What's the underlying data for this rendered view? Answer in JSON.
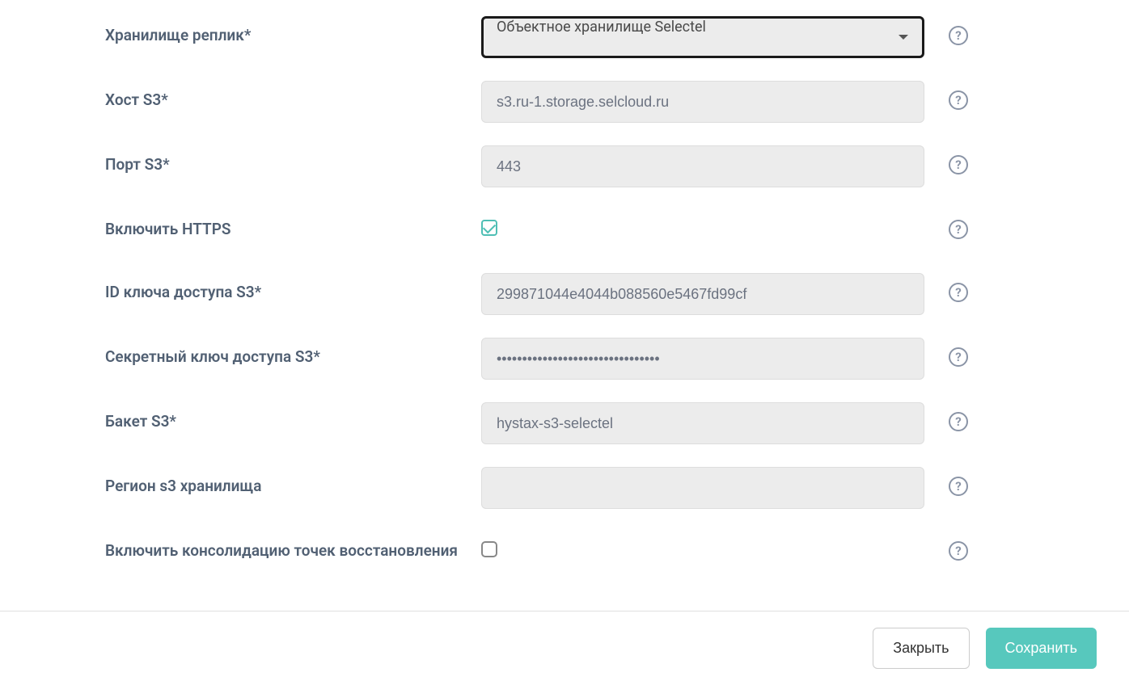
{
  "form": {
    "replicaStorage": {
      "label": "Хранилище реплик*",
      "value": "Объектное хранилище Selectel"
    },
    "s3Host": {
      "label": "Хост S3*",
      "value": "s3.ru-1.storage.selcloud.ru"
    },
    "s3Port": {
      "label": "Порт S3*",
      "value": "443"
    },
    "enableHttps": {
      "label": "Включить HTTPS",
      "checked": true
    },
    "s3AccessKeyId": {
      "label": "ID ключа доступа S3*",
      "value": "299871044e4044b088560e5467fd99cf"
    },
    "s3SecretKey": {
      "label": "Секретный ключ доступа S3*",
      "value": "••••••••••••••••••••••••••••••••"
    },
    "s3Bucket": {
      "label": "Бакет S3*",
      "value": "hystax-s3-selectel"
    },
    "s3Region": {
      "label": "Регион s3 хранилища",
      "value": ""
    },
    "enableConsolidation": {
      "label": "Включить консолидацию точек восстановления",
      "checked": false
    }
  },
  "footer": {
    "closeLabel": "Закрыть",
    "saveLabel": "Сохранить"
  }
}
